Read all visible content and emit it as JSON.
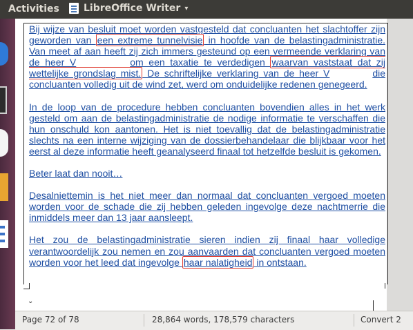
{
  "topbar": {
    "activities": "Activities",
    "app_name": "LibreOffice Writer",
    "app_caret": "▾"
  },
  "launcher": {
    "icons": [
      "browser-icon",
      "terminal-icon",
      "updater-icon",
      "files-icon",
      "writer-icon"
    ]
  },
  "document": {
    "p1": {
      "t1": "Bij wijze van besluit moet worden vastgesteld dat concluanten het slachtoffer zijn geworden van ",
      "h1": "een extreme tunnelvisie",
      "t2": " in hoofde van de belastingadministratie. Van meet af aan heeft zij zich immers gesteund op een vermeende verklaring van de heer V",
      "t3": "om een taxatie te verdedigen ",
      "h2": "waarvan vaststaat dat zij wettelijke grondslag mist.",
      "t4": " De schriftelijke verklaring van de heer V",
      "t5": "die concluanten volledig uit de wind zet, werd om onduidelijke redenen genegeerd."
    },
    "p2": "In de loop van de procedure hebben concluanten bovendien alles in het werk gesteld om aan de belastingadministratie de nodige informatie te verschaffen die hun onschuld kon aantonen. Het is niet toevallig dat de belastingadministratie slechts na een interne wijziging van de dossierbehandelaar die blijkbaar voor het eerst al deze informatie heeft geanalyseerd finaal tot hetzelfde besluit is gekomen.",
    "p3": "Beter laat dan nooit…",
    "p4": "Desalniettemin is het niet meer dan normaal dat concluanten vergoed moeten worden voor de schade die zij hebben geleden ingevolge deze nachtmerrie die inmiddels meer dan 13 jaar aansleept.",
    "p5": {
      "t1": "Het zou de belastingadministratie sieren indien zij finaal haar volledige verantwoordelijk zou nemen en zou aanvaarden dat concluanten vergoed moeten worden voor het leed dat ingevolge ",
      "h1": "haar nalatigheid",
      "t2": " in ontstaan."
    },
    "page_break_marker": "⌄"
  },
  "statusbar": {
    "page": "Page 72 of 78",
    "words": "28,864 words, 178,579 characters",
    "language": "Convert 2"
  },
  "colors": {
    "text": "#1f4fa3",
    "highlight_border": "#e03c31",
    "topbar": "#3c3b37"
  }
}
